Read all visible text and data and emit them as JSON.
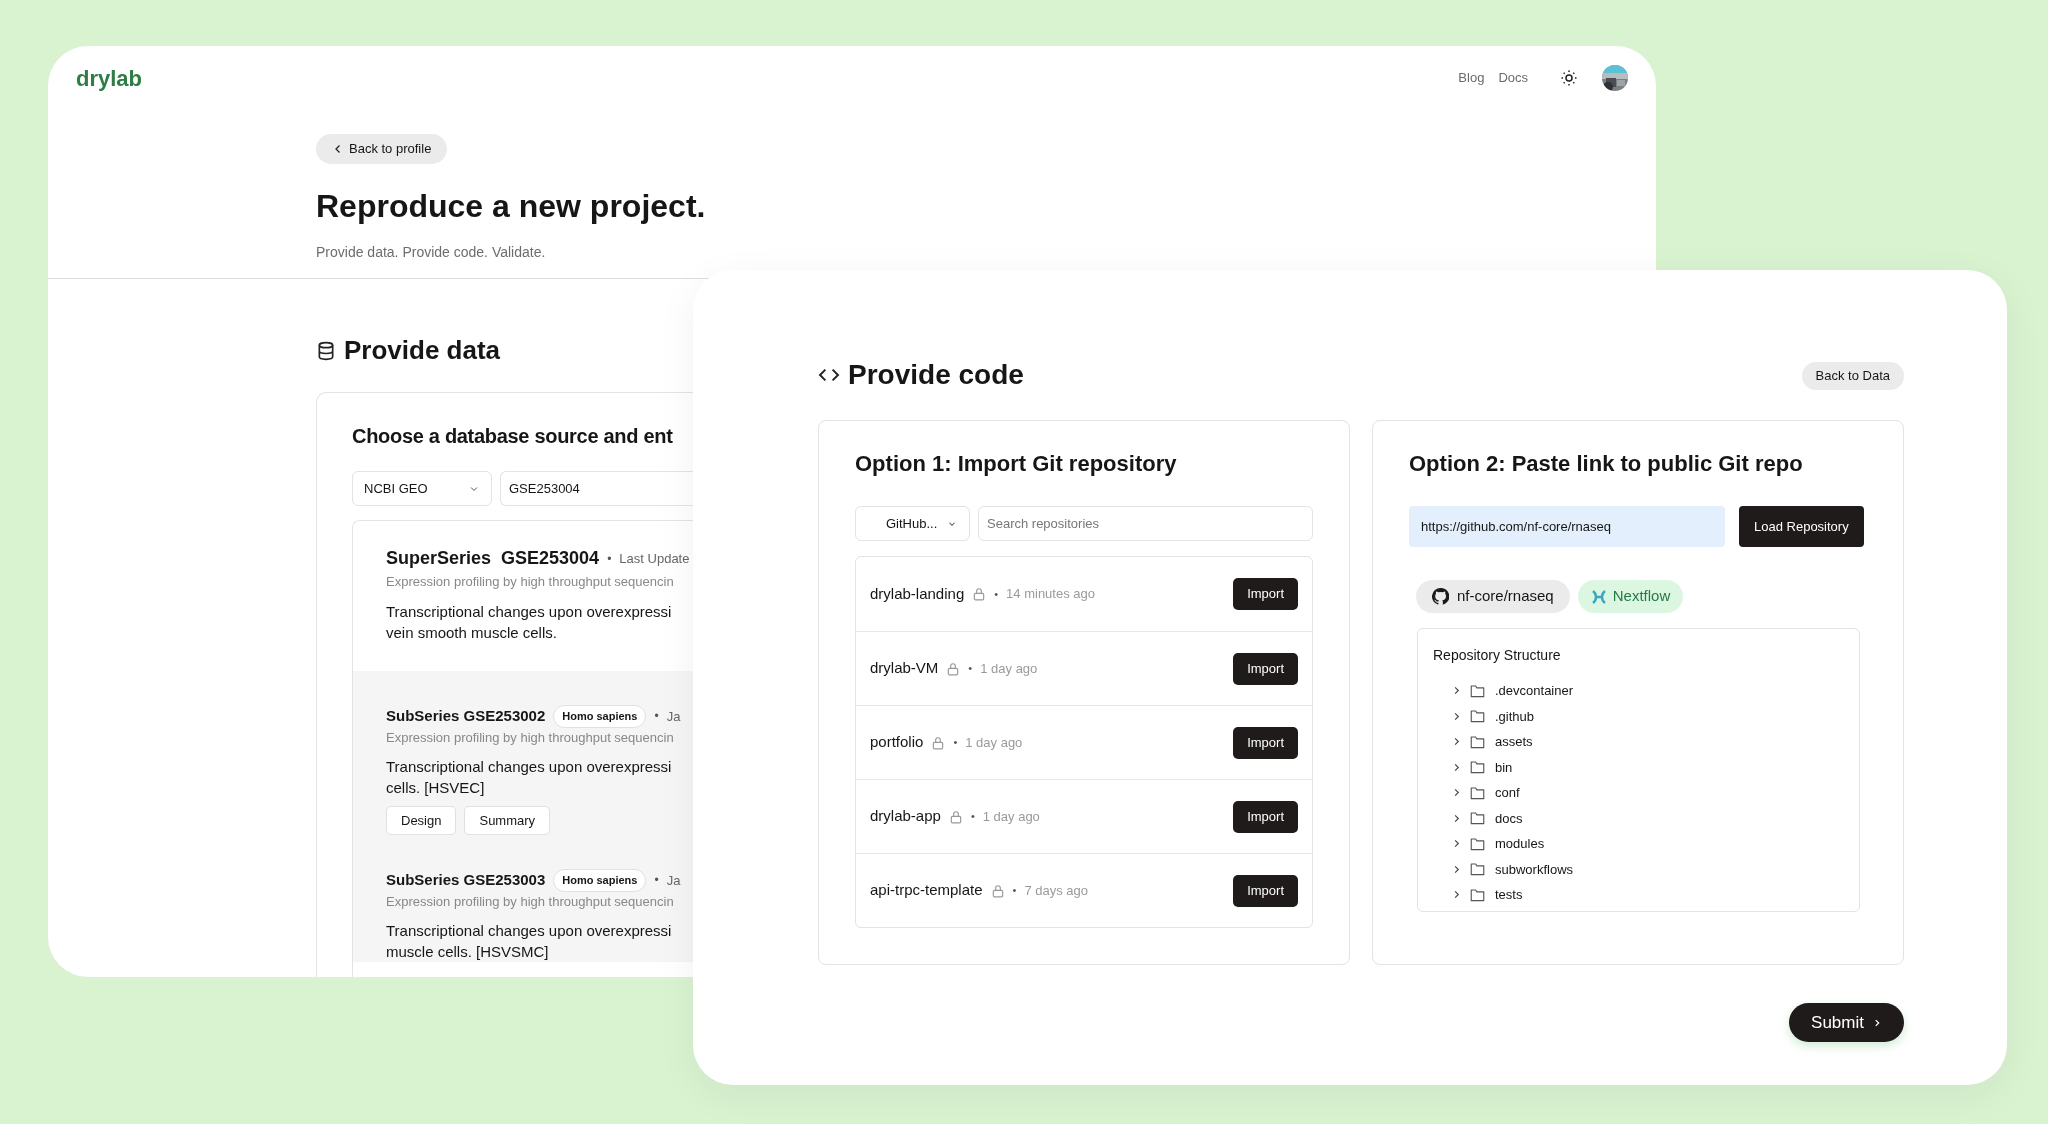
{
  "back_page": {
    "logo": "drylab",
    "nav": [
      "Blog",
      "Docs"
    ],
    "back_button": "Back to profile",
    "title": "Reproduce a new project.",
    "subtitle": "Provide data. Provide code. Validate.",
    "section_title": "Provide data",
    "card": {
      "title": "Choose a database source and ent",
      "source_select": "NCBI GEO",
      "accession_value": "GSE253004",
      "series": [
        {
          "kind": "superseries",
          "label": "SuperSeries",
          "accession": "GSE253004",
          "separator": "•",
          "meta": "Last Update",
          "type_line": "Expression profiling by high throughput sequencin",
          "summary": "Transcriptional changes upon overexpressi\nvein smooth muscle cells."
        },
        {
          "kind": "subseries",
          "label": "SubSeries",
          "accession": "GSE253002",
          "organism": "Homo sapiens",
          "separator": "•",
          "meta": "Ja",
          "type_line": "Expression profiling by high throughput sequencin",
          "summary": "Transcriptional changes upon overexpressi\ncells. [HSVEC]",
          "actions": [
            "Design",
            "Summary"
          ]
        },
        {
          "kind": "subseries",
          "label": "SubSeries",
          "accession": "GSE253003",
          "organism": "Homo sapiens",
          "separator": "•",
          "meta": "Ja",
          "type_line": "Expression profiling by high throughput sequencin",
          "summary": "Transcriptional changes upon overexpressi\nmuscle cells. [HSVSMC]"
        }
      ]
    }
  },
  "front_page": {
    "title": "Provide code",
    "back_button": "Back to Data",
    "option1": {
      "title": "Option 1: Import Git repository",
      "provider_select": "GitHub...",
      "search_placeholder": "Search repositories",
      "repos": [
        {
          "name": "drylab-landing",
          "private": true,
          "separator": "•",
          "updated": "14 minutes ago",
          "action": "Import"
        },
        {
          "name": "drylab-VM",
          "private": true,
          "separator": "•",
          "updated": "1 day ago",
          "action": "Import"
        },
        {
          "name": "portfolio",
          "private": true,
          "separator": "•",
          "updated": "1 day ago",
          "action": "Import"
        },
        {
          "name": "drylab-app",
          "private": true,
          "separator": "•",
          "updated": "1 day ago",
          "action": "Import"
        },
        {
          "name": "api-trpc-template",
          "private": true,
          "separator": "•",
          "updated": "7 days ago",
          "action": "Import"
        }
      ]
    },
    "option2": {
      "title": "Option 2: Paste link to public Git repo",
      "url_value": "https://github.com/nf-core/rnaseq",
      "load_button": "Load Repository",
      "repo_chip": "nf-core/rnaseq",
      "framework_chip": "Nextflow",
      "structure": {
        "title": "Repository Structure",
        "items": [
          {
            "name": ".devcontainer",
            "expanded": false
          },
          {
            "name": ".github",
            "expanded": false
          },
          {
            "name": "assets",
            "expanded": false
          },
          {
            "name": "bin",
            "expanded": false
          },
          {
            "name": "conf",
            "expanded": false
          },
          {
            "name": "docs",
            "expanded": false
          },
          {
            "name": "modules",
            "expanded": false
          },
          {
            "name": "subworkflows",
            "expanded": false
          },
          {
            "name": "tests",
            "expanded": false
          }
        ]
      }
    },
    "submit": "Submit"
  }
}
